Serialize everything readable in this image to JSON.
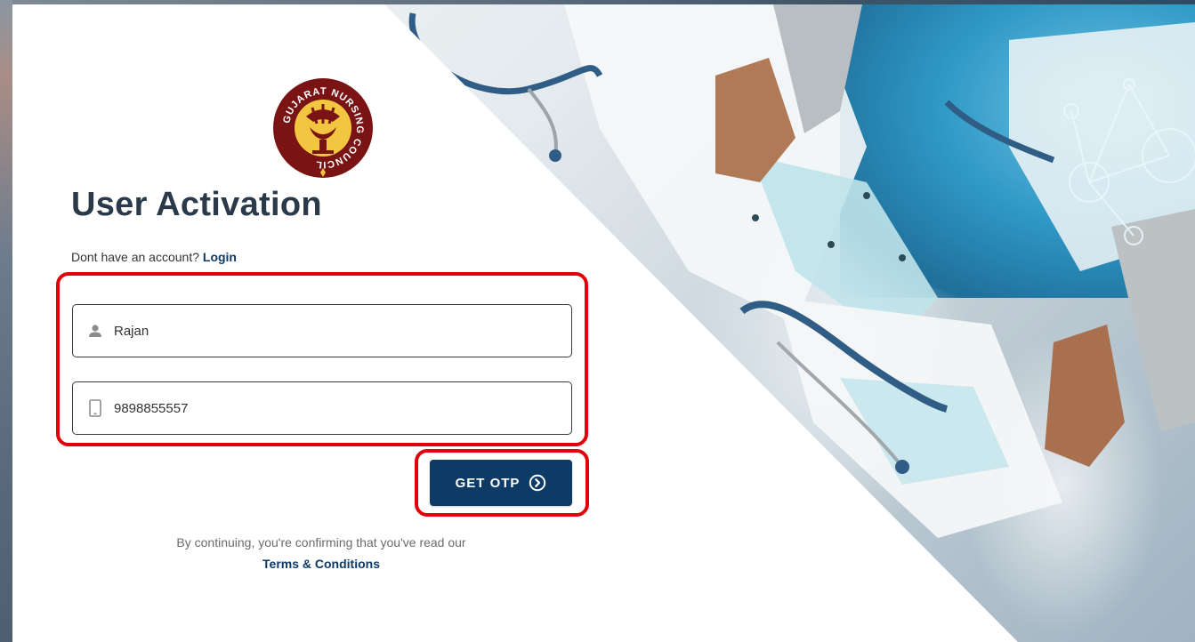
{
  "logo": {
    "text": "GUJARAT NURSING COUNCIL",
    "icon": "council-emblem-icon"
  },
  "page": {
    "title": "User Activation"
  },
  "account_prompt": {
    "text": "Dont have an account?",
    "link_label": "Login"
  },
  "form": {
    "name_field": {
      "value": "Rajan",
      "icon": "user-icon"
    },
    "mobile_field": {
      "value": "9898855557",
      "icon": "mobile-phone-icon"
    },
    "submit": {
      "label": "GET OTP",
      "icon": "chevron-right-circle-icon"
    }
  },
  "footer": {
    "text": "By continuing, you're confirming that you've read our",
    "link_label": "Terms & Conditions"
  },
  "colors": {
    "primary": "#0d3b66",
    "highlight": "#e0000b",
    "title": "#2b3a4a",
    "logo_ring": "#8b1a1a",
    "logo_fill": "#f4c542"
  }
}
